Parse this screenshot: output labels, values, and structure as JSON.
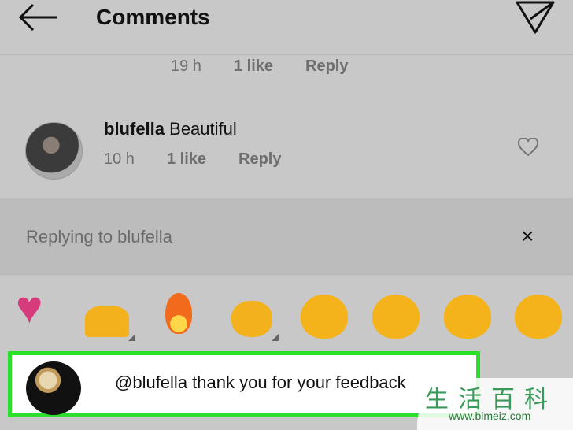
{
  "header": {
    "title": "Comments",
    "back_icon": "arrow-left-icon",
    "send_icon": "paper-plane-icon"
  },
  "comments": [
    {
      "time": "19 h",
      "likes": "1 like",
      "reply": "Reply"
    },
    {
      "username": "blufella",
      "text": "Beautiful",
      "time": "10 h",
      "likes": "1 like",
      "reply": "Reply",
      "like_icon": "heart-outline-icon"
    }
  ],
  "replying": {
    "label": "Replying to blufella",
    "close": "×"
  },
  "emojis": [
    "heart",
    "raised-hands",
    "fire",
    "clapping-hands",
    "sad-tear-face",
    "heart-eyes-face",
    "surprised-face",
    "grinning-face"
  ],
  "input": {
    "value": "@blufella thank you for your feedback",
    "highlight_color": "#2bdf2b"
  },
  "watermark": {
    "chars": "生活百科",
    "url": "www.bimeiz.com"
  }
}
